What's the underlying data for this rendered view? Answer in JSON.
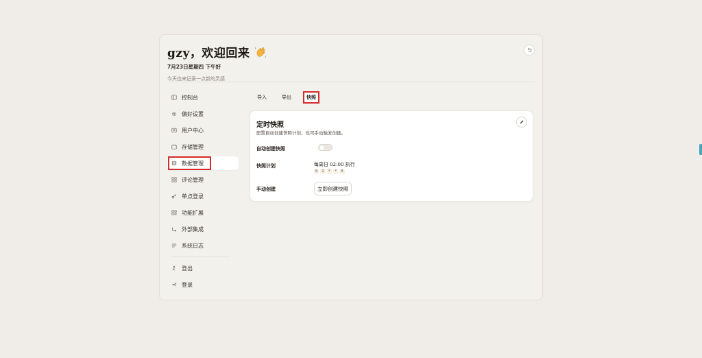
{
  "header": {
    "title": "gzy，欢迎回来",
    "date": "7月23日星期四  下午好",
    "subtitle": "今天也来记录一点新的灵感"
  },
  "sidebar": {
    "items": [
      {
        "label": "控制台",
        "icon": "dashboard-icon"
      },
      {
        "label": "偏好设置",
        "icon": "gear-icon"
      },
      {
        "label": "用户中心",
        "icon": "user-card-icon"
      },
      {
        "label": "存储管理",
        "icon": "storage-icon"
      },
      {
        "label": "数据管理",
        "icon": "database-icon"
      },
      {
        "label": "评论管理",
        "icon": "grid-icon"
      },
      {
        "label": "单点登录",
        "icon": "key-icon"
      },
      {
        "label": "功能扩展",
        "icon": "extension-icon"
      },
      {
        "label": "外部集成",
        "icon": "integration-icon"
      },
      {
        "label": "系统日志",
        "icon": "log-icon"
      }
    ],
    "bottom": [
      {
        "label": "登出",
        "icon": "logout-icon"
      },
      {
        "label": "登录",
        "icon": "login-icon"
      }
    ]
  },
  "tabs": [
    "导入",
    "导出",
    "快照"
  ],
  "card": {
    "title": "定时快照",
    "description": "配置自动创建快照计划，也可手动触发创建。",
    "auto_label": "自动创建快照",
    "schedule_label": "快照计划",
    "schedule_text": "每周日 02:00 执行",
    "cron": [
      "0",
      "2",
      "*",
      "*",
      "0"
    ],
    "manual_label": "手动创建",
    "manual_button": "立即创建快照",
    "auto_enabled": false
  },
  "colors": {
    "background": "#f0ede8",
    "highlight": "#d42a2a",
    "accent": "#4aa6b8"
  }
}
